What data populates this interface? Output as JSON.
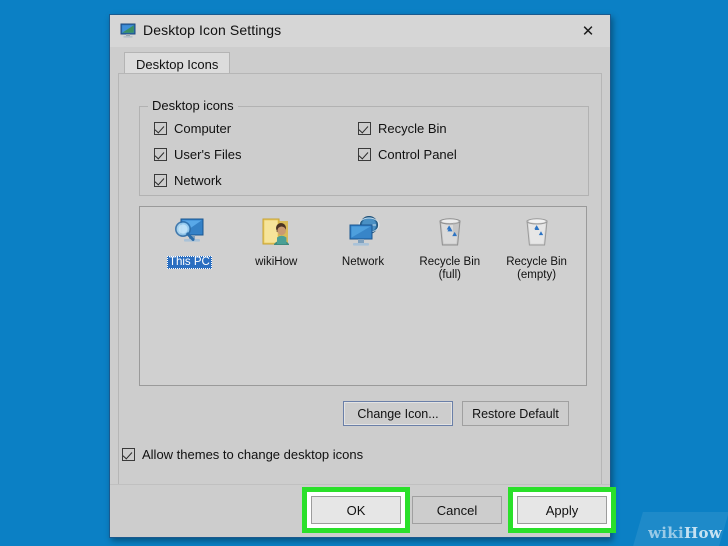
{
  "desktop": {
    "background_color": "#0b80c5"
  },
  "dialog": {
    "title": "Desktop Icon Settings",
    "title_icon": "monitor-icon",
    "close_label": "✕",
    "tabs": [
      {
        "label": "Desktop Icons",
        "active": true
      }
    ]
  },
  "group": {
    "legend": "Desktop icons",
    "checkboxes": [
      {
        "label": "Computer",
        "checked": true
      },
      {
        "label": "User's Files",
        "checked": true
      },
      {
        "label": "Network",
        "checked": true
      },
      {
        "label": "Recycle Bin",
        "checked": true
      },
      {
        "label": "Control Panel",
        "checked": true
      }
    ]
  },
  "icon_preview": {
    "items": [
      {
        "label": "This PC",
        "icon": "this-pc-icon",
        "selected": true
      },
      {
        "label": "wikiHow",
        "icon": "user-folder-icon",
        "selected": false
      },
      {
        "label": "Network",
        "icon": "network-icon",
        "selected": false
      },
      {
        "label": "Recycle Bin\n(full)",
        "icon": "recycle-bin-full-icon",
        "selected": false
      },
      {
        "label": "Recycle Bin\n(empty)",
        "icon": "recycle-bin-empty-icon",
        "selected": false
      }
    ]
  },
  "actions": {
    "change_icon": "Change Icon...",
    "restore_default": "Restore Default"
  },
  "allow_themes": {
    "label": "Allow themes to change desktop icons",
    "checked": true
  },
  "footer": {
    "ok": "OK",
    "cancel": "Cancel",
    "apply": "Apply",
    "highlight_color": "#2ae02a",
    "highlighted": [
      "OK",
      "Apply"
    ]
  },
  "watermark": {
    "text_1": "wiki",
    "text_2": "How"
  }
}
